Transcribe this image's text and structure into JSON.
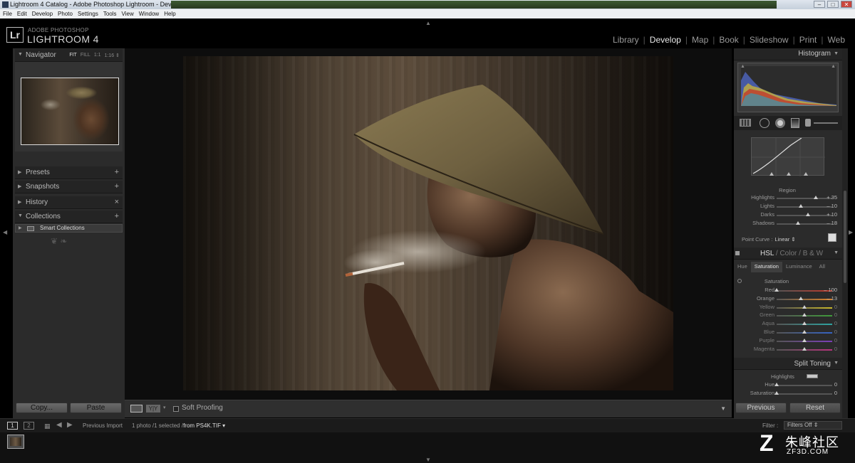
{
  "window": {
    "title": "Lightroom 4 Catalog - Adobe Photoshop Lightroom - Develop",
    "controls": [
      "–",
      "□",
      "✕"
    ]
  },
  "menu": [
    "File",
    "Edit",
    "Develop",
    "Photo",
    "Settings",
    "Tools",
    "View",
    "Window",
    "Help"
  ],
  "brand": {
    "badge": "Lr",
    "top": "ADOBE PHOTOSHOP",
    "main": "LIGHTROOM 4"
  },
  "modules": [
    {
      "label": "Library",
      "active": false
    },
    {
      "label": "Develop",
      "active": true
    },
    {
      "label": "Map",
      "active": false
    },
    {
      "label": "Book",
      "active": false
    },
    {
      "label": "Slideshow",
      "active": false
    },
    {
      "label": "Print",
      "active": false
    },
    {
      "label": "Web",
      "active": false
    }
  ],
  "left": {
    "navigator": {
      "label": "Navigator",
      "zoom": [
        "FIT",
        "FILL",
        "1:1",
        "1:16 ⇕"
      ]
    },
    "presets": {
      "label": "Presets",
      "action": "+"
    },
    "snapshots": {
      "label": "Snapshots",
      "action": "+"
    },
    "history": {
      "label": "History",
      "action": "×"
    },
    "collections": {
      "label": "Collections",
      "action": "+",
      "item": "Smart Collections"
    },
    "ornament": "❦ ❧",
    "copy_label": "Copy...",
    "paste_label": "Paste"
  },
  "toolbar": {
    "yy": "Y|Y",
    "dropdown": "▾",
    "soft_proofing": "Soft Proofing",
    "menu": "▼"
  },
  "right": {
    "histogram": {
      "label": "Histogram"
    },
    "tone_curve": {
      "region_label": "Region",
      "sliders": [
        {
          "name": "Highlights",
          "value": "+ 35",
          "pos": 0.7
        },
        {
          "name": "Lights",
          "value": "– 10",
          "pos": 0.43
        },
        {
          "name": "Darks",
          "value": "+ 10",
          "pos": 0.57
        },
        {
          "name": "Shadows",
          "value": "– 18",
          "pos": 0.38
        }
      ],
      "point_curve_label": "Point Curve :",
      "point_curve_value": "Linear ⇕"
    },
    "hsl": {
      "hsl": "HSL",
      "color": "Color",
      "bw": "B & W",
      "sep": "/",
      "tabs": [
        "Hue",
        "Saturation",
        "Luminance",
        "All"
      ],
      "active_tab": "Saturation",
      "section_label": "Saturation",
      "sliders": [
        {
          "name": "Red",
          "value": "– 100",
          "pos": 0.0,
          "color": "#c0392b",
          "dim": false
        },
        {
          "name": "Orange",
          "value": "– 13",
          "pos": 0.43,
          "color": "#d9822b",
          "dim": false
        },
        {
          "name": "Yellow",
          "value": "0",
          "pos": 0.5,
          "color": "#c8b72a",
          "dim": true
        },
        {
          "name": "Green",
          "value": "0",
          "pos": 0.5,
          "color": "#3f9a3a",
          "dim": true
        },
        {
          "name": "Aqua",
          "value": "0",
          "pos": 0.5,
          "color": "#2ea3a0",
          "dim": true
        },
        {
          "name": "Blue",
          "value": "0",
          "pos": 0.5,
          "color": "#3563c2",
          "dim": true
        },
        {
          "name": "Purple",
          "value": "0",
          "pos": 0.5,
          "color": "#7a3fb8",
          "dim": true
        },
        {
          "name": "Magenta",
          "value": "0",
          "pos": 0.5,
          "color": "#b8337d",
          "dim": true
        }
      ]
    },
    "split_toning": {
      "label": "Split Toning",
      "highlights_label": "Highlights",
      "sliders": [
        {
          "name": "Hue",
          "value": "0",
          "pos": 0.0
        },
        {
          "name": "Saturation",
          "value": "0",
          "pos": 0.0
        }
      ]
    },
    "previous_label": "Previous",
    "reset_label": "Reset"
  },
  "filmbar": {
    "view1": "1",
    "view2": "2",
    "source": "Previous Import",
    "count_prefix": "1 photo /1 selected /",
    "filename": "from PS4K.TIF ▾",
    "filter_label": "Filter :",
    "filter_value": "Filters Off ⇕"
  },
  "watermark": {
    "mark": "Z",
    "name": "朱峰社区",
    "url": "ZF3D.COM"
  },
  "colors": {
    "accent": "#e8e8e8",
    "panel": "#2b2b2b",
    "background": "#000000"
  }
}
